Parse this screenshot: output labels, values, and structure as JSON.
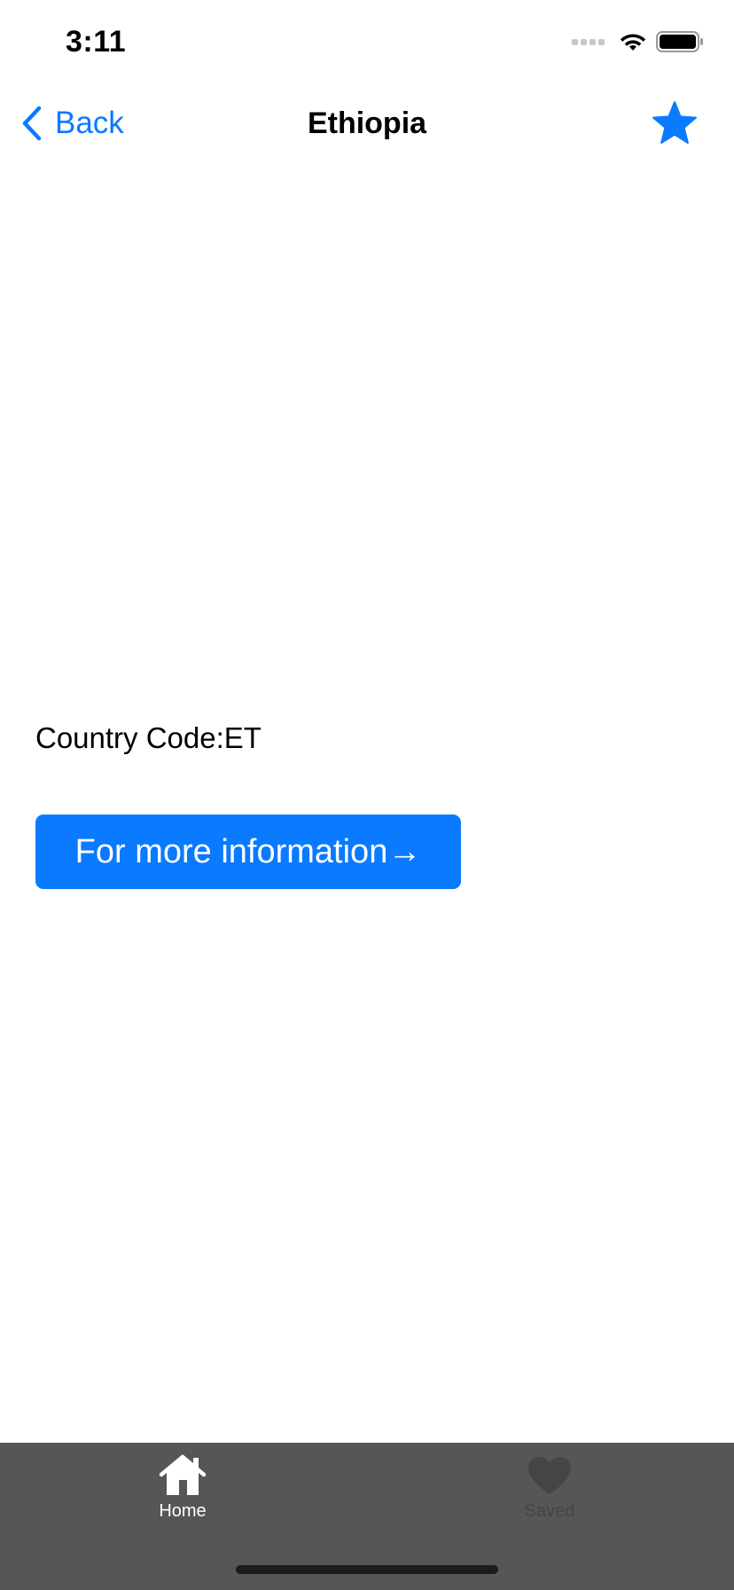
{
  "status_bar": {
    "time": "3:11"
  },
  "nav": {
    "back_label": "Back",
    "title": "Ethiopia",
    "favorite_icon": "star-icon",
    "accent_color": "#0a7aff"
  },
  "content": {
    "country_code_text": "Country Code:ET",
    "more_info_label": "For more information→"
  },
  "tab_bar": {
    "background": "#565656",
    "tabs": [
      {
        "label": "Home",
        "icon": "house-icon",
        "selected": true
      },
      {
        "label": "Saved",
        "icon": "heart-icon",
        "selected": false
      }
    ]
  }
}
